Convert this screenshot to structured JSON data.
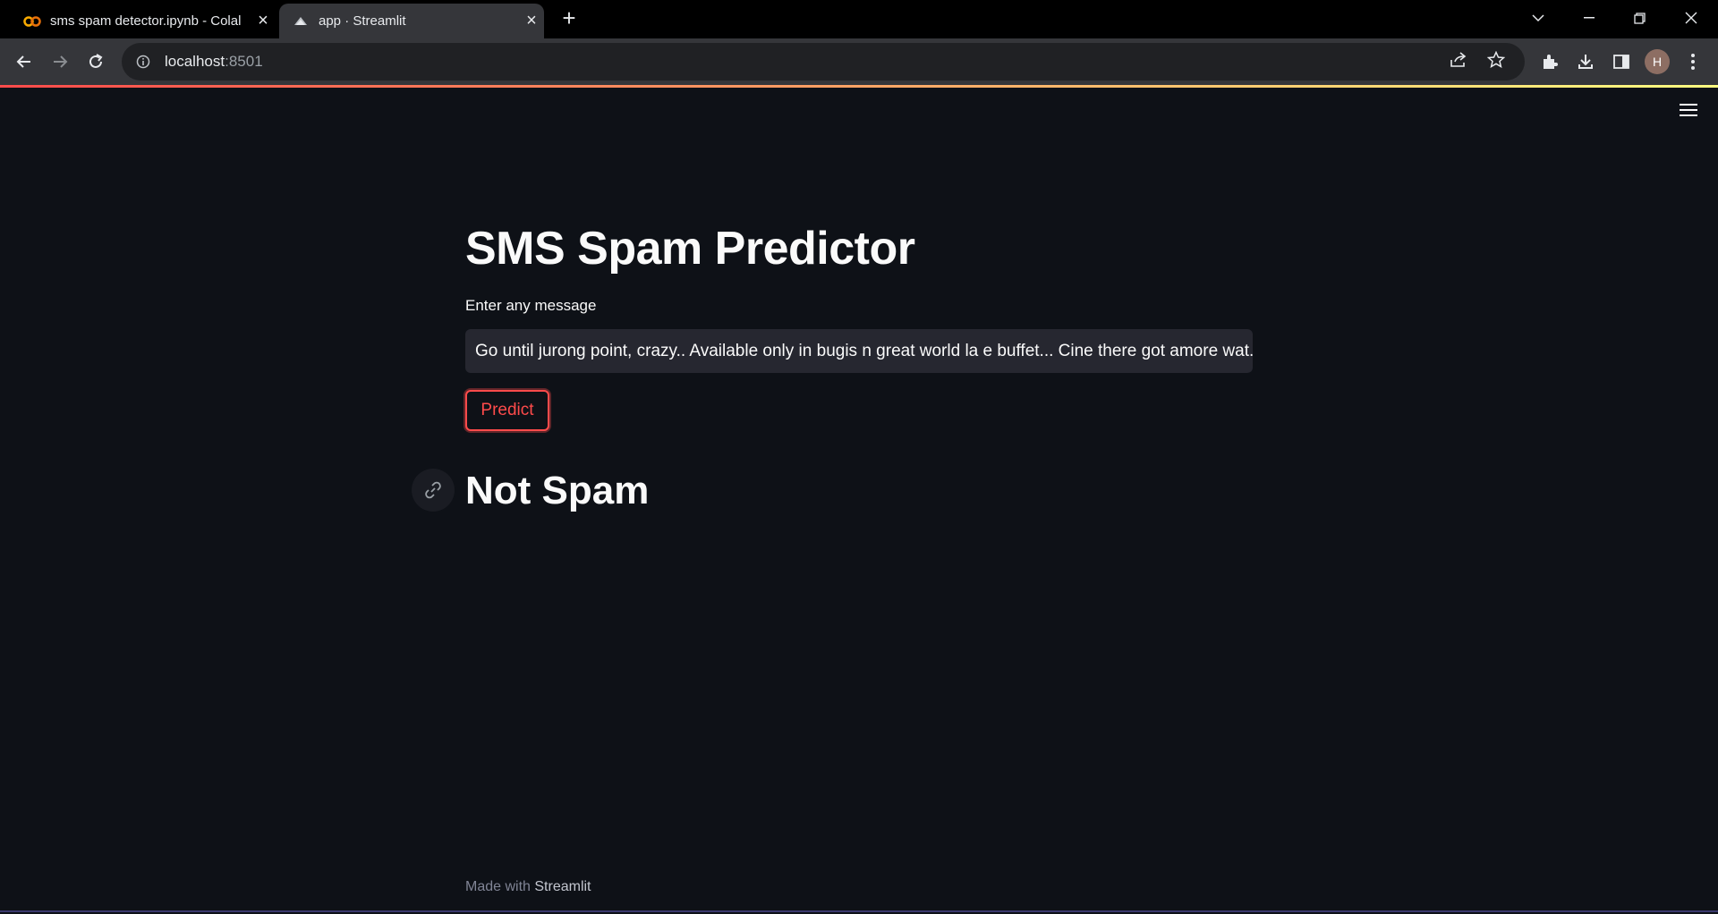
{
  "browser": {
    "tabs": [
      {
        "title": "sms spam detector.ipynb - Colal",
        "icon": "colab-icon",
        "active": false
      },
      {
        "title": "app · Streamlit",
        "icon": "streamlit-icon",
        "active": true
      }
    ],
    "address": {
      "host": "localhost",
      "port": ":8501"
    },
    "profile_initial": "H"
  },
  "app": {
    "title": "SMS Spam Predictor",
    "input": {
      "label": "Enter any message",
      "value": "Go until jurong point, crazy.. Available only in bugis n great world la e buffet... Cine there got amore wat."
    },
    "predict_button": "Predict",
    "result": "Not Spam",
    "footer": {
      "prefix": "Made with ",
      "brand": "Streamlit"
    }
  },
  "colors": {
    "background": "#0e1117",
    "accent": "#ff4b4b",
    "input_bg": "#262730",
    "text": "#fafafa"
  }
}
